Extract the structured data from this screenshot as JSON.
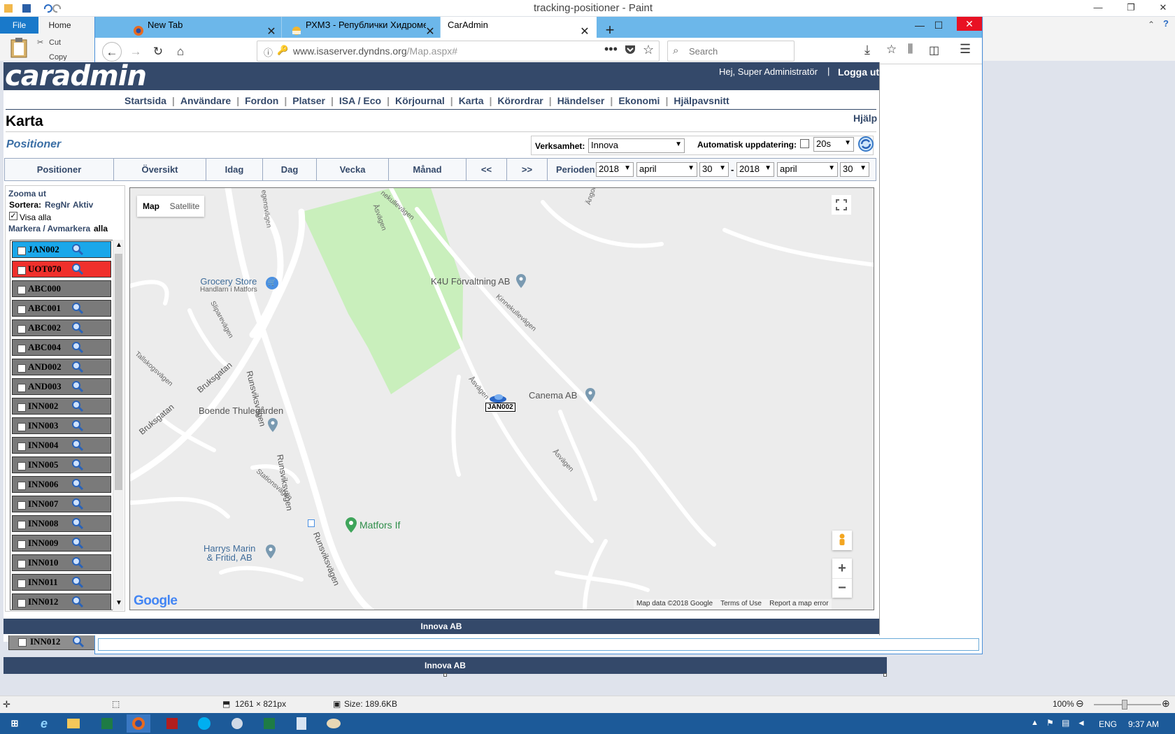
{
  "paint": {
    "title": "tracking-positioner - Paint",
    "file_tab": "File",
    "home_tab": "Home",
    "cut": "Cut",
    "copy": "Copy",
    "status": {
      "dimensions": "1261 × 821px",
      "size": "Size: 189.6KB",
      "zoom": "100%"
    }
  },
  "browser": {
    "tabs": [
      {
        "label": "New Tab"
      },
      {
        "label": "РХМЗ - Републички Хидроме"
      },
      {
        "label": "CarAdmin"
      }
    ],
    "url_host": "www.isaserver.dyndns.org",
    "url_path": "/Map.aspx#",
    "search_placeholder": "Search"
  },
  "caradmin": {
    "logo": "caradmin",
    "greeting": "Hej, Super Administratör",
    "logout": "Logga ut",
    "menu": [
      "Startsida",
      "Användare",
      "Fordon",
      "Platser",
      "ISA / Eco",
      "Körjournal",
      "Karta",
      "Körordrar",
      "Händelser",
      "Ekonomi",
      "Hjälpavsnitt"
    ],
    "page_title": "Karta",
    "help": "Hjälp",
    "subtitle": "Positioner",
    "verksamhet_label": "Verksamhet:",
    "verksamhet_value": "Innova",
    "auto_update_label": "Automatisk uppdatering:",
    "auto_update_interval": "20s",
    "period_buttons": [
      "Positioner",
      "Översikt",
      "Idag",
      "Dag",
      "Vecka",
      "Månad",
      "<<",
      ">>"
    ],
    "period_label": "Perioden:",
    "period_from": {
      "year": "2018",
      "month": "april",
      "day": "30"
    },
    "period_dash": "-",
    "period_to": {
      "year": "2018",
      "month": "april",
      "day": "30"
    },
    "zoom_out": "Zooma ut",
    "sort_label": "Sortera:",
    "sort_regnr": "RegNr",
    "sort_aktiv": "Aktiv",
    "show_all": "Visa alla",
    "mark_unmark": "Markera / Avmarkera",
    "mark_all": "alla",
    "vehicles": [
      {
        "reg": "JAN002",
        "status_color": "#1aa7ea",
        "zoom": true
      },
      {
        "reg": "UOT070",
        "status_color": "#f0302c",
        "zoom": true
      },
      {
        "reg": "ABC000",
        "status_color": "#7a7a7a",
        "zoom": false
      },
      {
        "reg": "ABC001",
        "status_color": "#7a7a7a",
        "zoom": true
      },
      {
        "reg": "ABC002",
        "status_color": "#7a7a7a",
        "zoom": true
      },
      {
        "reg": "ABC004",
        "status_color": "#7a7a7a",
        "zoom": true
      },
      {
        "reg": "AND002",
        "status_color": "#7a7a7a",
        "zoom": true
      },
      {
        "reg": "AND003",
        "status_color": "#7a7a7a",
        "zoom": true
      },
      {
        "reg": "INN002",
        "status_color": "#7a7a7a",
        "zoom": true
      },
      {
        "reg": "INN003",
        "status_color": "#7a7a7a",
        "zoom": true
      },
      {
        "reg": "INN004",
        "status_color": "#7a7a7a",
        "zoom": true
      },
      {
        "reg": "INN005",
        "status_color": "#7a7a7a",
        "zoom": true
      },
      {
        "reg": "INN006",
        "status_color": "#7a7a7a",
        "zoom": true
      },
      {
        "reg": "INN007",
        "status_color": "#7a7a7a",
        "zoom": true
      },
      {
        "reg": "INN008",
        "status_color": "#7a7a7a",
        "zoom": true
      },
      {
        "reg": "INN009",
        "status_color": "#7a7a7a",
        "zoom": true
      },
      {
        "reg": "INN010",
        "status_color": "#7a7a7a",
        "zoom": true
      },
      {
        "reg": "INN011",
        "status_color": "#7a7a7a",
        "zoom": true
      },
      {
        "reg": "INN012",
        "status_color": "#7a7a7a",
        "zoom": true
      }
    ],
    "footer": "Innova AB"
  },
  "map": {
    "type_map": "Map",
    "type_satellite": "Satellite",
    "attribution": "Map data ©2018 Google",
    "terms": "Terms of Use",
    "report": "Report a map error",
    "google": "Google",
    "vehicle_marker": "JAN002",
    "places": {
      "grocery": "Grocery Store",
      "grocery_sub": "Handlarn i Matfors",
      "k4u": "K4U Förvaltning AB",
      "canema": "Canema AB",
      "boende": "Boende Thulegården",
      "matfors": "Matfors If",
      "harrys": "Harrys Marin",
      "harrys2": "& Fritid, AB"
    },
    "streets": {
      "runsviks1": "Runsviksvägen",
      "runsviks2": "Runsviksvägen",
      "runsviks3": "Runsviksvägen",
      "bruks1": "Bruksgatan",
      "bruks2": "Bruksgatan",
      "asv1": "Åsvägen",
      "asv2": "Åsvägen",
      "asv3": "Åsvägen",
      "kinne1": "Kinnekullevägen",
      "kinne2": "nekullevägen",
      "talls": "Tallskogsvägen",
      "slip": "Sliparevägen",
      "station": "Stationsvägen",
      "egens": "egensvägen",
      "angom": "Ängomsvägen"
    }
  },
  "captured_image": {
    "row_label": "INN012",
    "footer": "Innova AB"
  },
  "taskbar": {
    "lang": "ENG",
    "time": "9:37 AM"
  }
}
